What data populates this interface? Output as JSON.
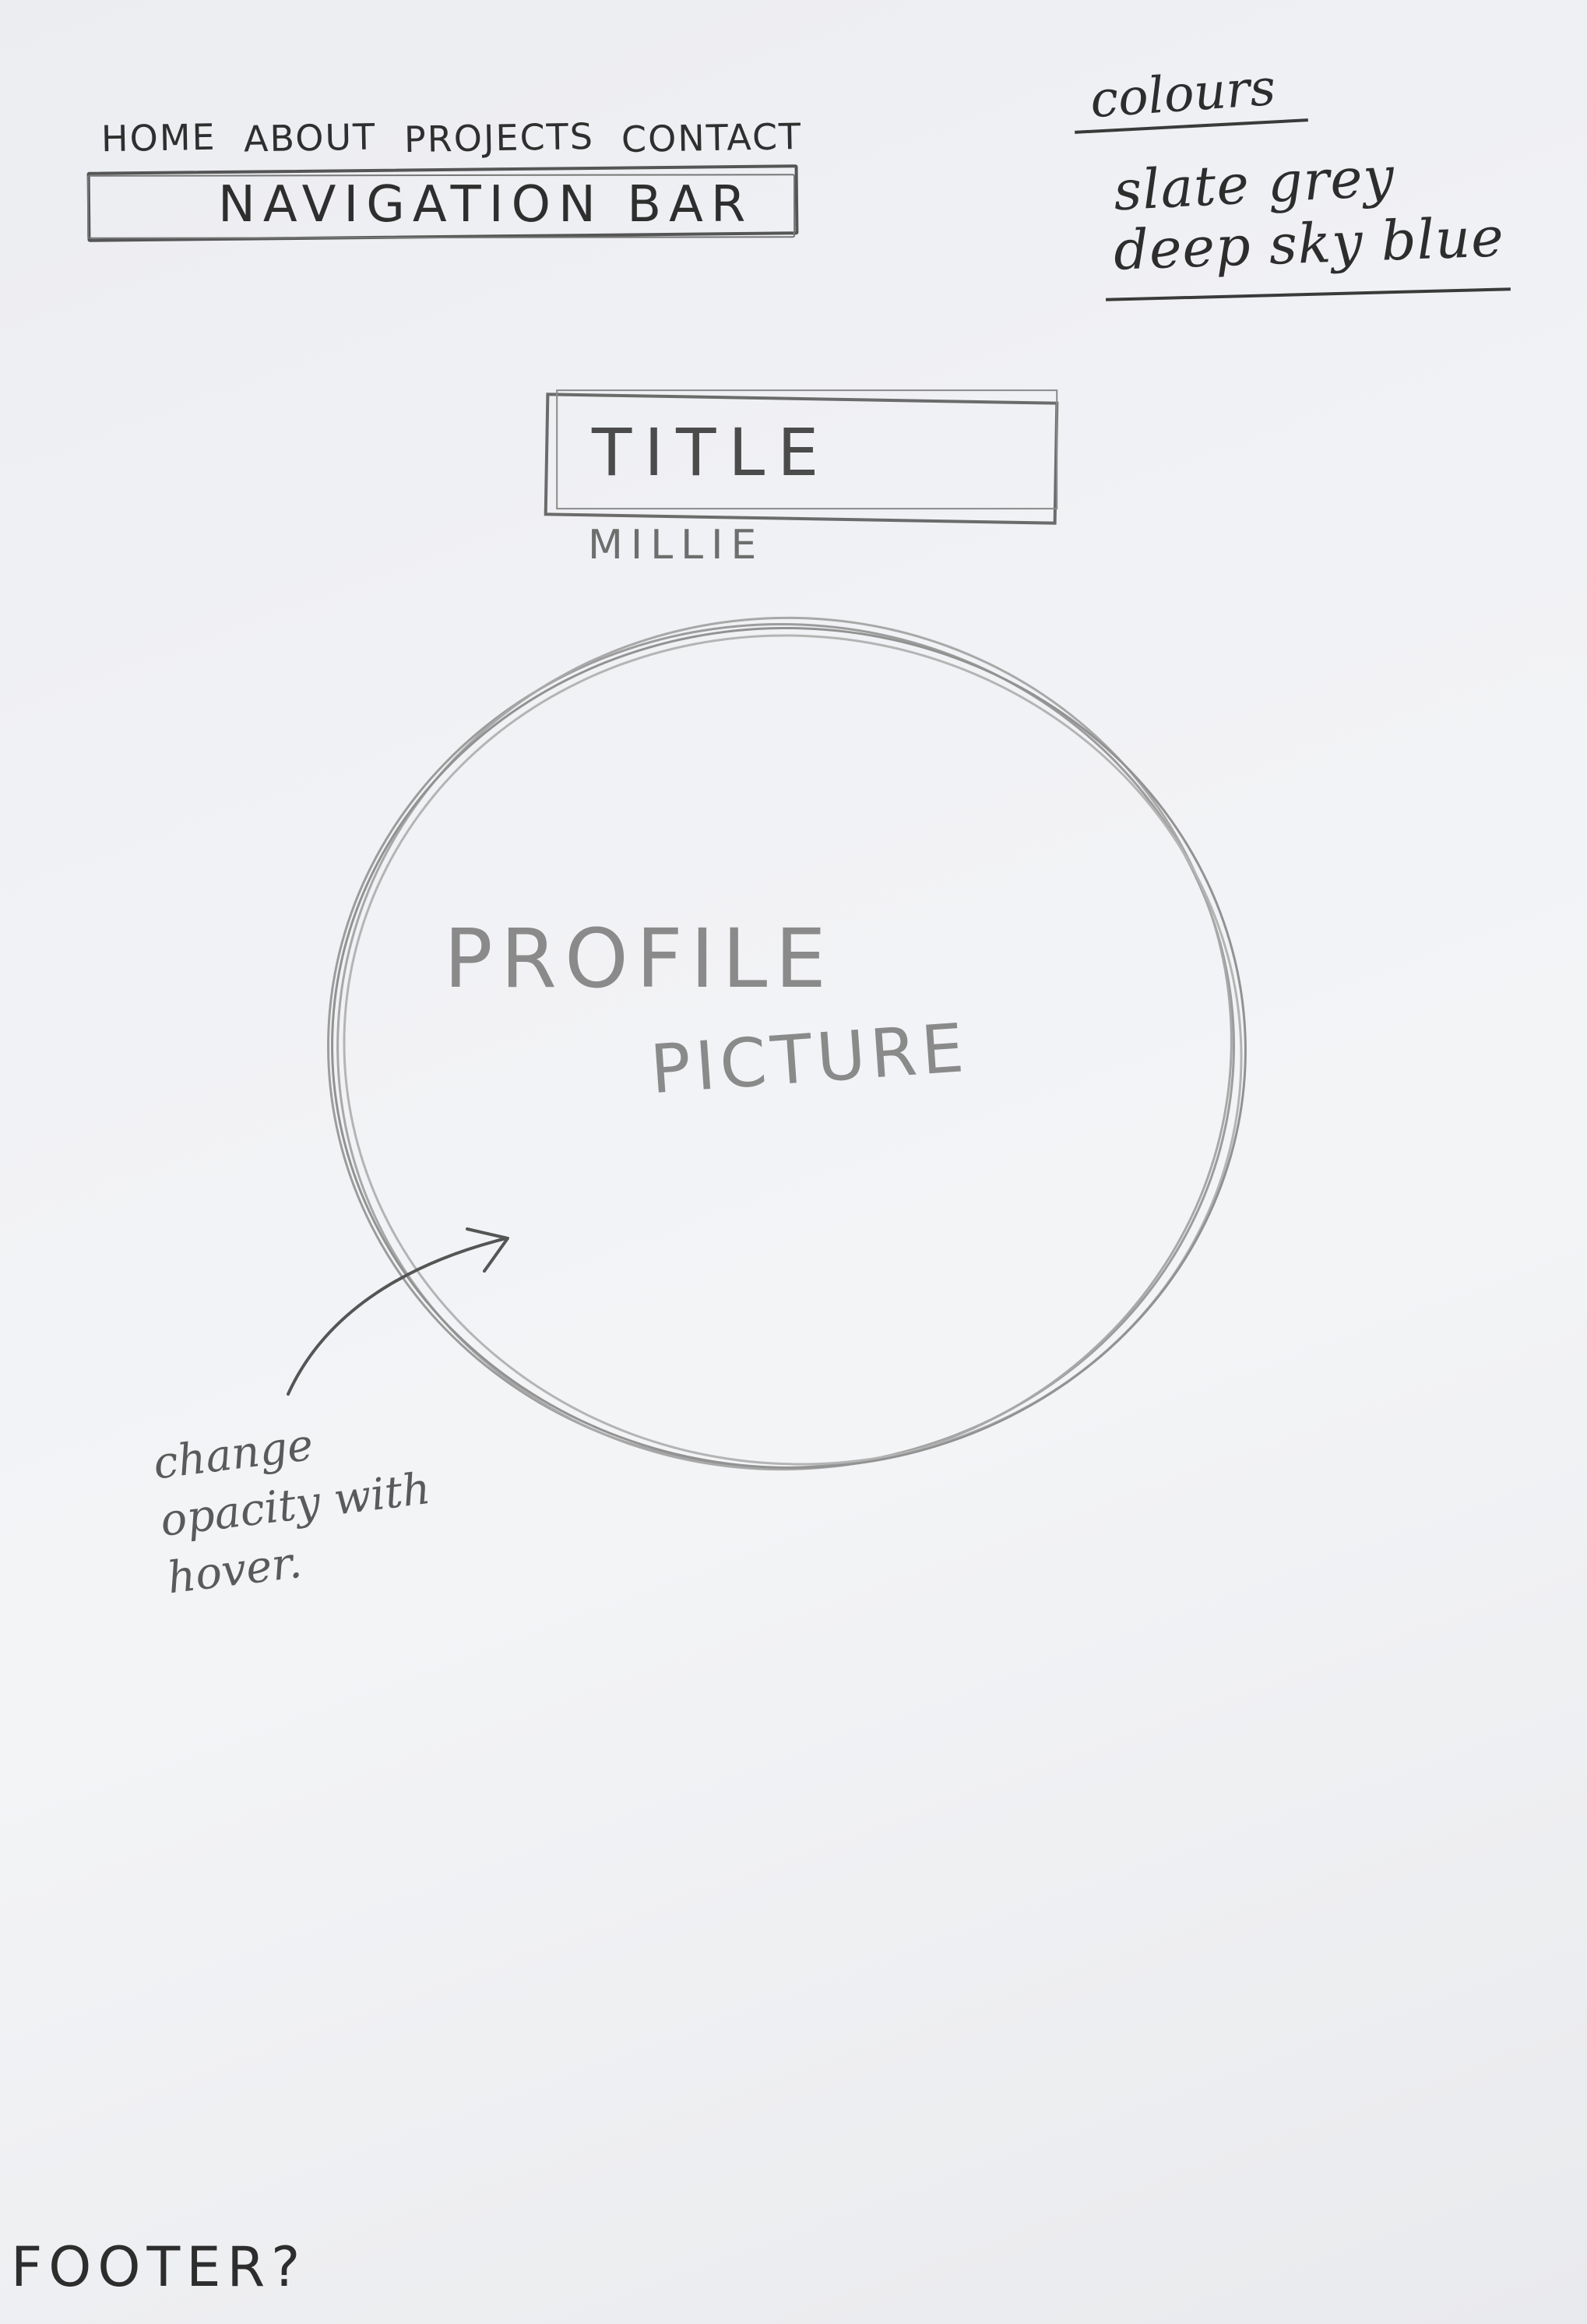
{
  "navigation": {
    "links": [
      "HOME",
      "ABOUT",
      "PROJECTS",
      "CONTACT"
    ],
    "bar_label": "NAVIGATION BAR"
  },
  "colours": {
    "heading": "colours",
    "items": [
      "slate grey",
      "deep sky blue"
    ]
  },
  "header": {
    "title_label": "TITLE",
    "subtitle": "MILLIE"
  },
  "profile": {
    "label_line1": "PROFILE",
    "label_line2": "PICTURE",
    "annotation": "change opacity with hover."
  },
  "footer": {
    "label": "FOOTER?"
  }
}
